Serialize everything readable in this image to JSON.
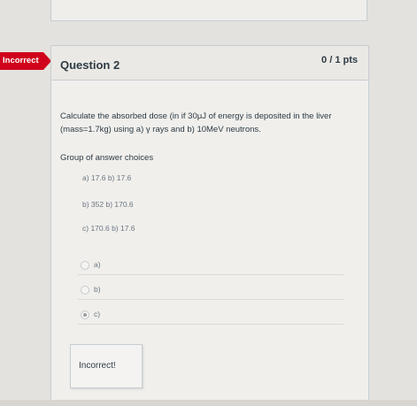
{
  "status_flag": "Incorrect",
  "question": {
    "title": "Question 2",
    "points": "0 / 1 pts",
    "text": "Calculate the absorbed dose (in  if 30μJ of energy is deposited in the liver (mass=1.7kg) using a) γ rays and b) 10MeV neutrons."
  },
  "choices_group": {
    "label": "Group of answer choices",
    "options": [
      "a) 17.6 b) 17.6",
      "b) 352 b) 170.6",
      "c) 170.6 b) 17.6"
    ]
  },
  "answers": [
    {
      "label": "a)",
      "selected": false
    },
    {
      "label": "b)",
      "selected": false
    },
    {
      "label": "c)",
      "selected": true
    }
  ],
  "feedback": "Incorrect!",
  "colors": {
    "flag": "#d0021b",
    "text": "#2d3b45"
  }
}
